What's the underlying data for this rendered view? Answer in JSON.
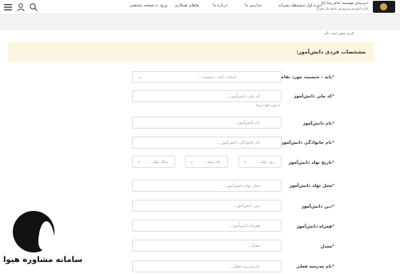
{
  "header": {
    "brand_line1": "دبیرستان هوشمند امام رضا (ع)",
    "brand_line2": "اداره آموزش و پرورش ناحیه یک شیراز",
    "nav": [
      "دوره اول متوسطه پسرانه",
      "مدارس ما",
      "درباره ما",
      "نقاهای همکاری",
      "ورود به صفحه شخصی"
    ]
  },
  "breadcrumb": "فرم پیش ثبت نام",
  "section_title": "مشخصات فردی دانش‌آموز:",
  "fields": {
    "grade": {
      "label": "پایه - جنسیت مورد تقاضا",
      "placeholder": "انتخاب پایه - جنسیت..."
    },
    "national_code": {
      "label": "کد ملی دانش‌آموز",
      "placeholder": "کد ملی دانش‌آموز...",
      "note": "(بدون خط تیره)"
    },
    "first_name": {
      "label": "نام دانش‌آموز",
      "placeholder": "نام دانش‌آموز..."
    },
    "last_name": {
      "label": "نام خانوادگی دانش‌آموز",
      "placeholder": "نام خانوادگی دانش‌آموز..."
    },
    "birth_date": {
      "label": "تاریخ تولد دانش‌آموز",
      "day": "روز تولد...",
      "month": "ماه تولد...",
      "year": "سال تولد..."
    },
    "birth_place": {
      "label": "محل تولد دانش‌آموز",
      "placeholder": "محل تولد دانش‌آموز..."
    },
    "religion": {
      "label": "دین دانش‌آموز",
      "placeholder": "دین دانش‌آموز..."
    },
    "mobile": {
      "label": "همراه دانش‌آموز",
      "placeholder": "همراه دانش‌آموز..."
    },
    "average": {
      "label": "معدل",
      "placeholder": "معدل..."
    },
    "school": {
      "label": "نام مدرسه فعلی",
      "placeholder": "نام مدرسه فعلی..."
    }
  },
  "watermark": {
    "text": "سامانه مشاوره هیوا"
  }
}
